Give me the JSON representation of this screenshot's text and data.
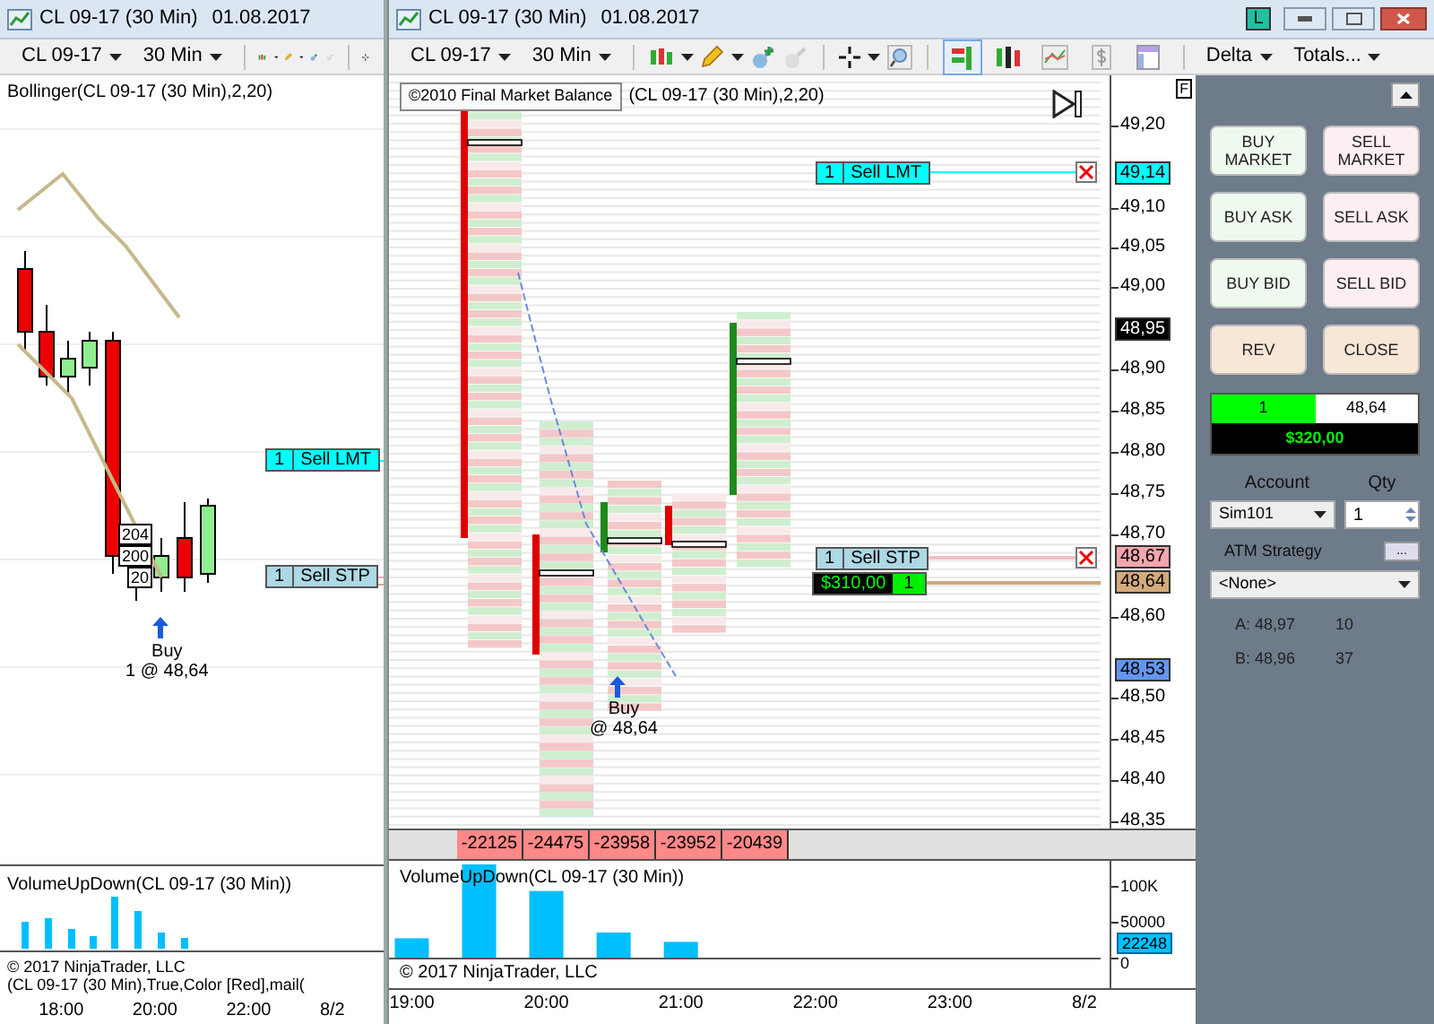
{
  "left_window": {
    "title": "CL 09-17 (30 Min)",
    "date": "01.08.2017",
    "instrument": "CL 09-17",
    "period": "30 Min",
    "indicator_label": "Bollinger(CL 09-17 (30 Min),2,20)",
    "orders": [
      {
        "qty": "1",
        "label": "Sell LMT",
        "color": "#00ffff"
      },
      {
        "qty": "1",
        "label": "Sell STP",
        "color": "#add8e6"
      }
    ],
    "bar_labels": [
      "204",
      "200",
      "20"
    ],
    "fill": {
      "side": "Buy",
      "text": "1 @ 48,64"
    },
    "volume_label": "VolumeUpDown(CL 09-17 (30 Min))",
    "copyright": "© 2017 NinjaTrader, LLC",
    "indicator_label_2": "(CL 09-17 (30 Min),True,Color [Red],mail(",
    "time_axis": [
      "18:00",
      "20:00",
      "22:00",
      "8/2"
    ]
  },
  "window": {
    "title": "CL 09-17 (30 Min)",
    "date": "01.08.2017",
    "badge": "L"
  },
  "toolbar": {
    "instrument": "CL 09-17",
    "period": "30 Min",
    "delta": "Delta",
    "totals": "Totals...",
    "tool_icons": [
      {
        "kind": "footprint",
        "selected": true
      },
      {
        "kind": "bars",
        "selected": false
      },
      {
        "kind": "line",
        "selected": false
      },
      {
        "kind": "dollar",
        "selected": false
      },
      {
        "kind": "panel",
        "selected": false
      }
    ]
  },
  "chart": {
    "tooltip": "©2010 Final Market Balance",
    "indicator_label": "(CL 09-17 (30 Min),2,20)",
    "flag": "F",
    "orders": [
      {
        "qty": "1",
        "label": "Sell LMT",
        "color": "#00ffff"
      },
      {
        "qty": "1",
        "label": "Sell STP",
        "color": "#add8e6"
      }
    ],
    "position": {
      "pnl": "$310,00",
      "qty": "1"
    },
    "fill": {
      "side": "Buy",
      "text": "@ 48,64"
    },
    "price_axis": [
      {
        "kind": "tick",
        "label": "49,20"
      },
      {
        "kind": "marker",
        "label": "49,14",
        "color": "#00ffff"
      },
      {
        "kind": "tick",
        "label": "49,10"
      },
      {
        "kind": "tick",
        "label": "49,05"
      },
      {
        "kind": "tick",
        "label": "49,00"
      },
      {
        "kind": "marker",
        "label": "48,95",
        "color": "#000000"
      },
      {
        "kind": "tick",
        "label": "48,90"
      },
      {
        "kind": "tick",
        "label": "48,85"
      },
      {
        "kind": "tick",
        "label": "48,80"
      },
      {
        "kind": "tick",
        "label": "48,75"
      },
      {
        "kind": "tick",
        "label": "48,70"
      },
      {
        "kind": "marker",
        "label": "48,67",
        "color": "#f4a6ae"
      },
      {
        "kind": "marker",
        "label": "48,64",
        "color": "#d2aa7c"
      },
      {
        "kind": "tick",
        "label": "48,60"
      },
      {
        "kind": "marker",
        "label": "48,53",
        "color": "#6495ed"
      },
      {
        "kind": "tick",
        "label": "48,50"
      },
      {
        "kind": "tick",
        "label": "48,45"
      },
      {
        "kind": "tick",
        "label": "48,40"
      },
      {
        "kind": "tick",
        "label": "48,35"
      }
    ],
    "deltas": [
      "-22125",
      "-24475",
      "-23958",
      "-23952",
      "-20439"
    ]
  },
  "volume": {
    "copyright": "© 2017 NinjaTrader, LLC",
    "last_value": "22248",
    "chart_data": {
      "type": "bar",
      "title": "VolumeUpDown(CL 09-17 (30 Min))",
      "x": [
        19,
        19.5,
        20,
        20.5,
        21
      ],
      "values": [
        27000,
        130000,
        93000,
        35000,
        22000
      ],
      "xlim": [
        18.83,
        24.8
      ],
      "ylim": [
        0,
        130000
      ],
      "yticks": [
        0,
        50000,
        {
          "value": 100000,
          "label": "100K"
        }
      ],
      "xticks": [
        {
          "value": 19,
          "label": "19:00"
        },
        {
          "value": 20,
          "label": "20:00"
        },
        {
          "value": 21,
          "label": "21:00"
        },
        {
          "value": 22,
          "label": "22:00"
        },
        {
          "value": 23,
          "label": "23:00"
        },
        {
          "value": 24,
          "label": "8/2"
        }
      ]
    }
  },
  "panel": {
    "order_buttons": [
      {
        "label": "BUY MARKET",
        "kind": "buy"
      },
      {
        "label": "SELL MARKET",
        "kind": "sell"
      },
      {
        "label": "BUY ASK",
        "kind": "buy"
      },
      {
        "label": "SELL ASK",
        "kind": "sell"
      },
      {
        "label": "BUY BID",
        "kind": "buy"
      },
      {
        "label": "SELL BID",
        "kind": "sell"
      },
      {
        "label": "REV",
        "kind": "neutral"
      },
      {
        "label": "CLOSE",
        "kind": "neutral"
      }
    ],
    "position": {
      "qty": "1",
      "price": "48,64",
      "pnl": "$320,00"
    },
    "account": {
      "label": "Account",
      "value": "Sim101"
    },
    "qty": {
      "label": "Qty",
      "value": "1"
    },
    "atm": {
      "label": "ATM Strategy",
      "button": "...",
      "value": "<None>"
    },
    "quotes": [
      {
        "label": "A: 48,97",
        "size": "10"
      },
      {
        "label": "B: 48,96",
        "size": "37"
      }
    ]
  }
}
